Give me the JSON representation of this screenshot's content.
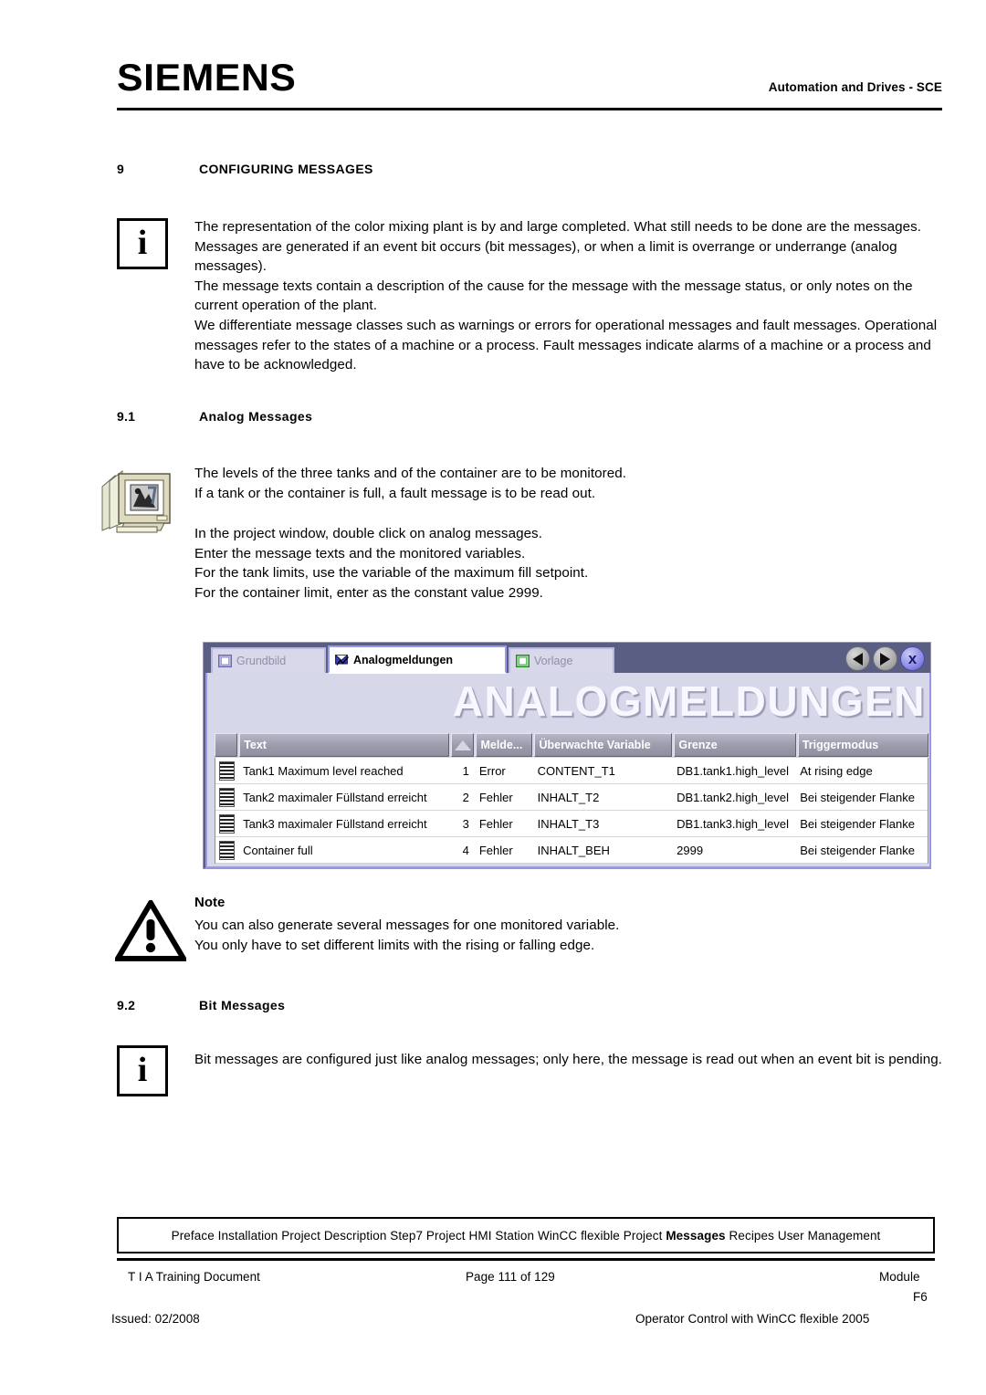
{
  "header": {
    "logo": "SIEMENS",
    "right_text": "Automation and Drives - SCE"
  },
  "sections": {
    "chapter": {
      "number": "9",
      "title": "CONFIGURING MESSAGES"
    },
    "s91": {
      "number": "9.1",
      "title": "Analog Messages"
    },
    "s92": {
      "number": "9.2",
      "title": "Bit Messages"
    }
  },
  "icons": {
    "info": "i",
    "warning": "!",
    "monitor": "monitor-icon"
  },
  "intro": {
    "p1": "The representation of the color mixing plant is by and large completed. What still needs to be done are the messages. Messages are generated if an event bit occurs (bit messages), or when a limit is overrange or underrange (analog messages).",
    "p2": "The message texts contain a description of the cause for the message with the message status, or only notes on the current operation of the plant.",
    "p3": "We differentiate message classes such as warnings or errors for operational messages and  fault messages. Operational messages refer to the states of a machine or a process.  Fault messages indicate alarms of a machine or a process and have to be acknowledged."
  },
  "analog_intro": {
    "l1": "The levels of the three tanks and of the container are to be monitored.",
    "l2": "If a tank or the container is full, a fault message is to be read out.",
    "l3": "In the project window, double click on analog messages.",
    "l4": "Enter the message texts and the monitored variables.",
    "l5": "For the tank limits, use the variable of the maximum fill setpoint.",
    "l6": "For the container limit, enter as the constant value  2999."
  },
  "note": {
    "label": "Note",
    "l1": "You can also generate several messages for one monitored variable.",
    "l2": "You only have to set different limits with the rising or falling edge."
  },
  "bit_intro": {
    "l1": "Bit messages are configured just like analog messages; only here, the message is read out when an event bit is pending."
  },
  "hmi": {
    "tabs": [
      {
        "label": "Grundbild",
        "icon": "screen-icon",
        "active": false
      },
      {
        "label": "Analogmeldungen",
        "icon": "analog-message-icon",
        "active": true
      },
      {
        "label": "Vorlage",
        "icon": "template-icon",
        "active": false
      }
    ],
    "window_buttons": [
      {
        "name": "back-button",
        "glyph": "◀"
      },
      {
        "name": "forward-button",
        "glyph": "▶"
      },
      {
        "name": "close-button",
        "glyph": "x"
      }
    ],
    "title": "ANALOGMELDUNGEN",
    "table": {
      "columns": [
        "",
        "Text",
        "",
        "Melde...",
        "Überwachte Variable",
        "Grenze",
        "Triggermodus"
      ],
      "rows": [
        {
          "text": "Tank1 Maximum level reached",
          "number": "1",
          "class": "Error",
          "variable": "CONTENT_T1",
          "limit": "DB1.tank1.high_level",
          "trigger": "At rising edge"
        },
        {
          "text": "Tank2 maximaler Füllstand erreicht",
          "number": "2",
          "class": "Fehler",
          "variable": "INHALT_T2",
          "limit": "DB1.tank2.high_level",
          "trigger": "Bei steigender Flanke"
        },
        {
          "text": "Tank3 maximaler Füllstand erreicht",
          "number": "3",
          "class": "Fehler",
          "variable": "INHALT_T3",
          "limit": "DB1.tank3.high_level",
          "trigger": "Bei steigender Flanke"
        },
        {
          "text": "Container full",
          "number": "4",
          "class": "Fehler",
          "variable": "INHALT_BEH",
          "limit": "2999",
          "trigger": "Bei steigender Flanke"
        }
      ]
    }
  },
  "footer": {
    "breadcrumb_pre": "Preface Installation Project Description Step7 Project HMI Station WinCC flexible Project ",
    "breadcrumb_bold": "Messages",
    "breadcrumb_post": " Recipes User Management",
    "doc_type": "T I A  Training Document",
    "page": "Page 111 of 129",
    "module_label": "Module",
    "module_id": "F6",
    "issued": "Issued: 02/2008",
    "course": "Operator Control with WinCC flexible 2005"
  },
  "colors": {
    "hmi_frame": "#5b5e83",
    "hmi_body": "#d7d7ea",
    "tab_active_border": "#9a9ae6",
    "header_cell": "#9b9bab"
  }
}
